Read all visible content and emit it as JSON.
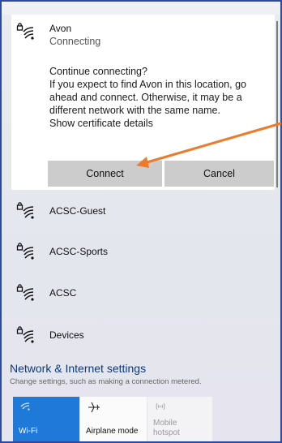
{
  "selected_network": {
    "name": "Avon",
    "status": "Connecting",
    "message_lines": [
      "Continue connecting?",
      "If you expect to find Avon in this location, go",
      "ahead and connect. Otherwise, it may be a",
      "different network with the same name.",
      "Show certificate details"
    ],
    "connect_label": "Connect",
    "cancel_label": "Cancel"
  },
  "networks": [
    {
      "name": "ACSC-Guest"
    },
    {
      "name": "ACSC-Sports"
    },
    {
      "name": "ACSC"
    },
    {
      "name": "Devices"
    }
  ],
  "settings": {
    "title": "Network & Internet settings",
    "subtitle": "Change settings, such as making a connection metered."
  },
  "quick_actions": {
    "wifi_label": "Wi-Fi",
    "airplane_label": "Airplane mode",
    "hotspot_label_1": "Mobile",
    "hotspot_label_2": "hotspot"
  },
  "colors": {
    "accent": "#1e79d8",
    "annotation_arrow": "#ef7a2c",
    "frame_border": "#2e4a9e"
  },
  "icons": {
    "secured_wifi": "wifi-lock-icon",
    "airplane": "airplane-icon",
    "hotspot": "hotspot-icon"
  }
}
